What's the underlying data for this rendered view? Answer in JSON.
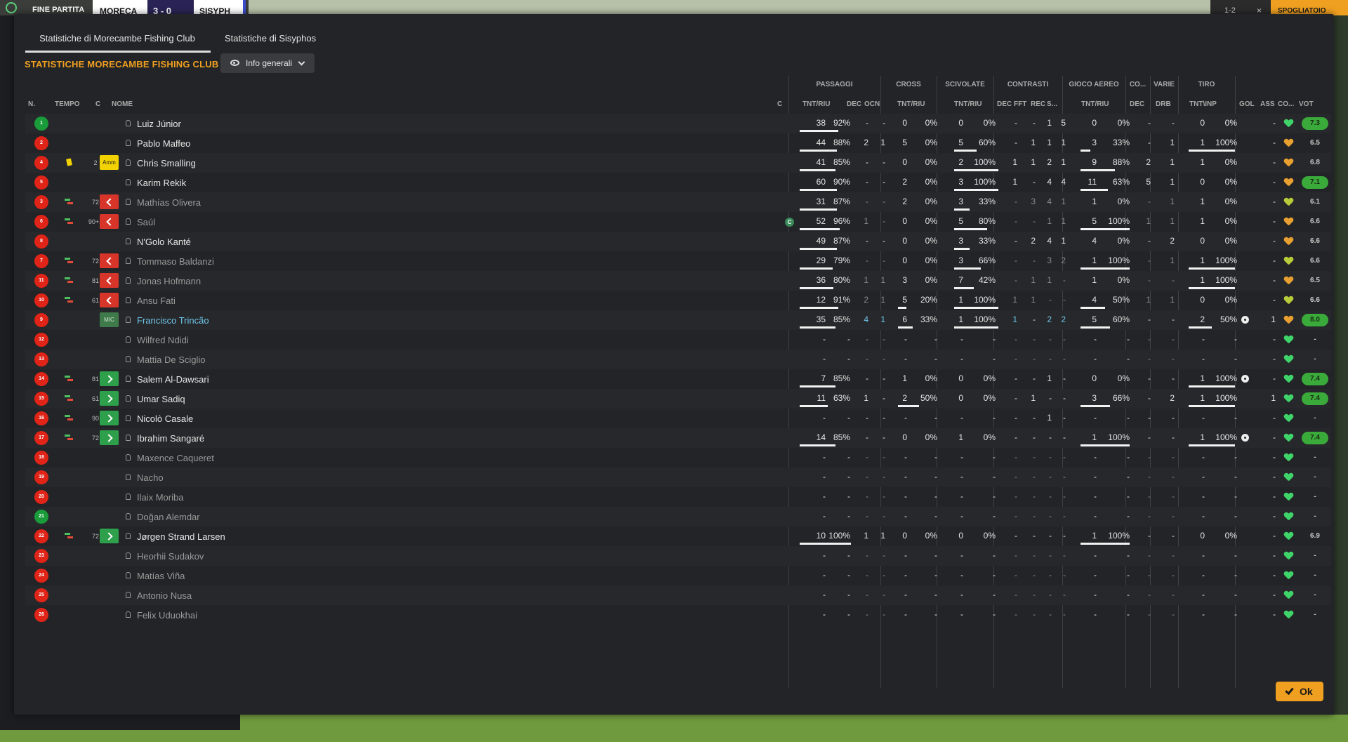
{
  "topbar": {
    "label": "FINE PARTITA",
    "team1": "MORECA",
    "score": "3 - 0",
    "team2": "SISYPH",
    "right1": "1-2",
    "right2": "×",
    "right3": "SPOGLIATOIO"
  },
  "dialog": {
    "tabs": [
      "Statistiche di Morecambe Fishing Club",
      "Statistiche di Sisyphos"
    ],
    "title": "STATISTICHE MORECAMBE FISHING CLUB",
    "dropdown": "Info generali",
    "ok": "Ok"
  },
  "groups": [
    "PASSAGGI",
    "CROSS",
    "SCIVOLATE",
    "CONTRASTI",
    "GIOCO AEREO",
    "CO...",
    "VARIE",
    "TIRO"
  ],
  "headers": {
    "n": "N.",
    "tempo": "TEMPO",
    "c": "C",
    "nome": "NOME",
    "c2": "C",
    "pass_tnt": "TNT/RIU",
    "pass_dec": "DEC",
    "pass_ocn": "OCN",
    "cross_tnt": "TNT/RIU",
    "sciv_tnt": "TNT/RIU",
    "con_dec": "DEC",
    "con_fft": "FFT",
    "con_rec": "REC",
    "con_s": "S...",
    "aer_tnt": "TNT/RIU",
    "co_dec": "DEC",
    "var_drb": "DRB",
    "tiro_tnt": "TNT\\INP",
    "gol": "GOL",
    "ass": "ASS",
    "co": "CO...",
    "vot": "VOT"
  },
  "accent": "#f0a020",
  "players": [
    {
      "n": "1",
      "nc": "green",
      "yellow": false,
      "sub": "",
      "min": "",
      "box": "",
      "name": "Luiz Júnior",
      "style": "",
      "capt": false,
      "p": [
        "38",
        "92%",
        "-",
        "-",
        "0",
        "0%",
        "0",
        "0%",
        "-",
        "-",
        "1",
        "5",
        "0",
        "0%",
        "-",
        "-",
        "0",
        "0%"
      ],
      "pw": [
        0.75,
        0,
        0.0,
        0
      ],
      "gol": "",
      "ass": "-",
      "heart": "g",
      "vot": "7.3",
      "votc": "g"
    },
    {
      "n": "2",
      "nc": "red",
      "yellow": false,
      "sub": "",
      "min": "",
      "box": "",
      "name": "Pablo Maffeo",
      "style": "",
      "capt": false,
      "p": [
        "44",
        "88%",
        "2",
        "1",
        "5",
        "0%",
        "5",
        "60%",
        "-",
        "1",
        "1",
        "1",
        "3",
        "33%",
        "-",
        "1",
        "1",
        "100%"
      ],
      "pw": [
        0.73,
        0,
        0.5,
        0.2,
        1
      ],
      "gol": "",
      "ass": "-",
      "heart": "o",
      "vot": "6.5",
      "votc": "n"
    },
    {
      "n": "4",
      "nc": "red",
      "yellow": true,
      "sub": "",
      "min": "2",
      "box": "amm",
      "boxlabel": "Amm",
      "name": "Chris Smalling",
      "style": "",
      "capt": false,
      "p": [
        "41",
        "85%",
        "-",
        "-",
        "0",
        "0%",
        "2",
        "100%",
        "1",
        "1",
        "2",
        "1",
        "9",
        "88%",
        "2",
        "1",
        "1",
        "0%"
      ],
      "pw": [
        0.7,
        0,
        1,
        0.7,
        0
      ],
      "gol": "",
      "ass": "-",
      "heart": "o",
      "vot": "6.8",
      "votc": "n"
    },
    {
      "n": "5",
      "nc": "red",
      "yellow": false,
      "sub": "",
      "min": "",
      "box": "",
      "name": "Karim Rekik",
      "style": "",
      "capt": false,
      "p": [
        "60",
        "90%",
        "-",
        "-",
        "2",
        "0%",
        "3",
        "100%",
        "1",
        "-",
        "4",
        "4",
        "11",
        "63%",
        "5",
        "1",
        "0",
        "0%"
      ],
      "pw": [
        0.73,
        0,
        1,
        0.55,
        0
      ],
      "gol": "",
      "ass": "-",
      "heart": "o",
      "vot": "7.1",
      "votc": "g"
    },
    {
      "n": "3",
      "nc": "red",
      "yellow": false,
      "sub": "swap",
      "min": "72",
      "box": "out",
      "name": "Mathías Olivera",
      "style": "dim",
      "capt": false,
      "p": [
        "31",
        "87%",
        "-",
        "-",
        "2",
        "0%",
        "3",
        "33%",
        "-",
        "3",
        "4",
        "1",
        "1",
        "0%",
        "-",
        "1",
        "1",
        "0%"
      ],
      "pw": [
        0.72,
        0,
        0.35,
        0,
        0
      ],
      "gol": "",
      "ass": "-",
      "heart": "y",
      "vot": "6.1",
      "votc": "n"
    },
    {
      "n": "6",
      "nc": "red",
      "yellow": false,
      "sub": "swap",
      "min": "90+1",
      "box": "out",
      "name": "Saúl",
      "style": "dim",
      "capt": true,
      "captlabel": "C",
      "p": [
        "52",
        "96%",
        "1",
        "-",
        "0",
        "0%",
        "5",
        "80%",
        "-",
        "-",
        "1",
        "1",
        "5",
        "100%",
        "1",
        "1",
        "1",
        "0%"
      ],
      "pw": [
        0.78,
        0,
        0.75,
        1,
        0
      ],
      "gol": "",
      "ass": "-",
      "heart": "o",
      "vot": "6.6",
      "votc": "n"
    },
    {
      "n": "8",
      "nc": "red",
      "yellow": false,
      "sub": "",
      "min": "",
      "box": "",
      "name": "N'Golo Kanté",
      "style": "",
      "capt": false,
      "p": [
        "49",
        "87%",
        "-",
        "-",
        "0",
        "0%",
        "3",
        "33%",
        "-",
        "2",
        "4",
        "1",
        "4",
        "0%",
        "-",
        "2",
        "0",
        "0%"
      ],
      "pw": [
        0.72,
        0,
        0.35,
        0,
        0
      ],
      "gol": "",
      "ass": "-",
      "heart": "o",
      "vot": "6.6",
      "votc": "n"
    },
    {
      "n": "7",
      "nc": "red",
      "yellow": false,
      "sub": "swap",
      "min": "72",
      "box": "out",
      "name": "Tommaso Baldanzi",
      "style": "dim",
      "capt": false,
      "p": [
        "29",
        "79%",
        "-",
        "-",
        "0",
        "0%",
        "3",
        "66%",
        "-",
        "-",
        "3",
        "2",
        "1",
        "100%",
        "-",
        "1",
        "1",
        "100%"
      ],
      "pw": [
        0.65,
        0,
        0.6,
        1,
        1
      ],
      "gol": "",
      "ass": "-",
      "heart": "y",
      "vot": "6.6",
      "votc": "n"
    },
    {
      "n": "11",
      "nc": "red",
      "yellow": false,
      "sub": "swap",
      "min": "81",
      "box": "out",
      "name": "Jonas Hofmann",
      "style": "dim",
      "capt": false,
      "p": [
        "36",
        "80%",
        "1",
        "1",
        "3",
        "0%",
        "7",
        "42%",
        "-",
        "1",
        "1",
        "-",
        "1",
        "0%",
        "-",
        "-",
        "1",
        "100%"
      ],
      "pw": [
        0.66,
        0,
        0.45,
        0,
        1
      ],
      "gol": "",
      "ass": "-",
      "heart": "o",
      "vot": "6.5",
      "votc": "n"
    },
    {
      "n": "10",
      "nc": "red",
      "yellow": false,
      "sub": "swap",
      "min": "61",
      "box": "out",
      "name": "Ansu Fati",
      "style": "dim",
      "capt": false,
      "p": [
        "12",
        "91%",
        "2",
        "1",
        "5",
        "20%",
        "1",
        "100%",
        "1",
        "1",
        "-",
        "-",
        "4",
        "50%",
        "1",
        "1",
        "0",
        "0%"
      ],
      "pw": [
        0.75,
        0.2,
        1,
        0.5,
        0
      ],
      "gol": "",
      "ass": "-",
      "heart": "y",
      "vot": "6.6",
      "votc": "n"
    },
    {
      "n": "9",
      "nc": "red",
      "yellow": false,
      "sub": "",
      "min": "",
      "box": "mic",
      "boxlabel": "MIC",
      "name": "Francisco Trincão",
      "style": "blue",
      "capt": false,
      "p": [
        "35",
        "85%",
        "4",
        "1",
        "6",
        "33%",
        "1",
        "100%",
        "1",
        "-",
        "2",
        "2",
        "5",
        "60%",
        "-",
        "-",
        "2",
        "50%"
      ],
      "pw": [
        0.7,
        0.35,
        1,
        0.6,
        0.5
      ],
      "gol": "ball",
      "ass": "1",
      "heart": "o",
      "vot": "8.0",
      "votc": "g"
    },
    {
      "n": "12",
      "nc": "red",
      "yellow": false,
      "sub": "",
      "min": "",
      "box": "",
      "name": "Wilfred Ndidi",
      "style": "dim",
      "capt": false,
      "p": [
        "-",
        "-",
        "-",
        "-",
        "-",
        "-",
        "-",
        "-",
        "-",
        "-",
        "-",
        "-",
        "-",
        "-",
        "-",
        "-",
        "-",
        "-"
      ],
      "pw": [],
      "gol": "",
      "ass": "-",
      "heart": "g",
      "vot": "-",
      "votc": "n"
    },
    {
      "n": "13",
      "nc": "red",
      "yellow": false,
      "sub": "",
      "min": "",
      "box": "",
      "name": "Mattia De Sciglio",
      "style": "dim",
      "capt": false,
      "p": [
        "-",
        "-",
        "-",
        "-",
        "-",
        "-",
        "-",
        "-",
        "-",
        "-",
        "-",
        "-",
        "-",
        "-",
        "-",
        "-",
        "-",
        "-"
      ],
      "pw": [],
      "gol": "",
      "ass": "-",
      "heart": "g",
      "vot": "-",
      "votc": "n"
    },
    {
      "n": "14",
      "nc": "red",
      "yellow": false,
      "sub": "swap",
      "min": "81",
      "box": "in",
      "name": "Salem Al-Dawsari",
      "style": "",
      "capt": false,
      "p": [
        "7",
        "85%",
        "-",
        "-",
        "1",
        "0%",
        "0",
        "0%",
        "-",
        "-",
        "1",
        "-",
        "0",
        "0%",
        "-",
        "-",
        "1",
        "100%"
      ],
      "pw": [
        0.7,
        0,
        0,
        0,
        1
      ],
      "gol": "ball",
      "ass": "-",
      "heart": "g",
      "vot": "7.4",
      "votc": "g"
    },
    {
      "n": "15",
      "nc": "red",
      "yellow": false,
      "sub": "swap",
      "min": "61",
      "box": "in",
      "name": "Umar Sadiq",
      "style": "",
      "capt": false,
      "p": [
        "11",
        "63%",
        "1",
        "-",
        "2",
        "50%",
        "0",
        "0%",
        "-",
        "1",
        "-",
        "-",
        "3",
        "66%",
        "-",
        "2",
        "1",
        "100%"
      ],
      "pw": [
        0.55,
        0.5,
        0,
        0.6,
        1
      ],
      "gol": "",
      "ass": "1",
      "heart": "g",
      "vot": "7.4",
      "votc": "g"
    },
    {
      "n": "16",
      "nc": "red",
      "yellow": false,
      "sub": "swap",
      "min": "90",
      "box": "in",
      "name": "Nicolò Casale",
      "style": "",
      "capt": false,
      "p": [
        "-",
        "-",
        "-",
        "-",
        "-",
        "-",
        "-",
        "-",
        "-",
        "-",
        "1",
        "-",
        "-",
        "-",
        "-",
        "-",
        "-",
        "-"
      ],
      "pw": [],
      "gol": "",
      "ass": "-",
      "heart": "g",
      "vot": "-",
      "votc": "n"
    },
    {
      "n": "17",
      "nc": "red",
      "yellow": false,
      "sub": "swap",
      "min": "72",
      "box": "in",
      "name": "Ibrahim Sangaré",
      "style": "",
      "capt": false,
      "p": [
        "14",
        "85%",
        "-",
        "-",
        "0",
        "0%",
        "1",
        "0%",
        "-",
        "-",
        "-",
        "-",
        "1",
        "100%",
        "-",
        "-",
        "1",
        "100%"
      ],
      "pw": [
        0.7,
        0,
        0,
        1,
        1
      ],
      "gol": "ball",
      "ass": "-",
      "heart": "g",
      "vot": "7.4",
      "votc": "g"
    },
    {
      "n": "18",
      "nc": "red",
      "yellow": false,
      "sub": "",
      "min": "",
      "box": "",
      "name": "Maxence Caqueret",
      "style": "dim",
      "capt": false,
      "p": [
        "-",
        "-",
        "-",
        "-",
        "-",
        "-",
        "-",
        "-",
        "-",
        "-",
        "-",
        "-",
        "-",
        "-",
        "-",
        "-",
        "-",
        "-"
      ],
      "pw": [],
      "gol": "",
      "ass": "-",
      "heart": "g",
      "vot": "-",
      "votc": "n"
    },
    {
      "n": "19",
      "nc": "red",
      "yellow": false,
      "sub": "",
      "min": "",
      "box": "",
      "name": "Nacho",
      "style": "dim",
      "capt": false,
      "p": [
        "-",
        "-",
        "-",
        "-",
        "-",
        "-",
        "-",
        "-",
        "-",
        "-",
        "-",
        "-",
        "-",
        "-",
        "-",
        "-",
        "-",
        "-"
      ],
      "pw": [],
      "gol": "",
      "ass": "-",
      "heart": "g",
      "vot": "-",
      "votc": "n"
    },
    {
      "n": "20",
      "nc": "red",
      "yellow": false,
      "sub": "",
      "min": "",
      "box": "",
      "name": "Ilaix Moriba",
      "style": "dim",
      "capt": false,
      "p": [
        "-",
        "-",
        "-",
        "-",
        "-",
        "-",
        "-",
        "-",
        "-",
        "-",
        "-",
        "-",
        "-",
        "-",
        "-",
        "-",
        "-",
        "-"
      ],
      "pw": [],
      "gol": "",
      "ass": "-",
      "heart": "g",
      "vot": "-",
      "votc": "n"
    },
    {
      "n": "21",
      "nc": "green",
      "yellow": false,
      "sub": "",
      "min": "",
      "box": "",
      "name": "Doğan Alemdar",
      "style": "dim",
      "capt": false,
      "p": [
        "-",
        "-",
        "-",
        "-",
        "-",
        "-",
        "-",
        "-",
        "-",
        "-",
        "-",
        "-",
        "-",
        "-",
        "-",
        "-",
        "-",
        "-"
      ],
      "pw": [],
      "gol": "",
      "ass": "-",
      "heart": "g",
      "vot": "-",
      "votc": "n"
    },
    {
      "n": "22",
      "nc": "red",
      "yellow": false,
      "sub": "swap",
      "min": "72",
      "box": "in",
      "name": "Jørgen Strand Larsen",
      "style": "",
      "capt": false,
      "p": [
        "10",
        "100%",
        "1",
        "1",
        "0",
        "0%",
        "0",
        "0%",
        "-",
        "-",
        "-",
        "-",
        "1",
        "100%",
        "-",
        "-",
        "0",
        "0%"
      ],
      "pw": [
        1,
        0,
        0,
        1,
        0
      ],
      "gol": "",
      "ass": "-",
      "heart": "g",
      "vot": "6.9",
      "votc": "n"
    },
    {
      "n": "23",
      "nc": "red",
      "yellow": false,
      "sub": "",
      "min": "",
      "box": "",
      "name": "Heorhii Sudakov",
      "style": "dim",
      "capt": false,
      "p": [
        "-",
        "-",
        "-",
        "-",
        "-",
        "-",
        "-",
        "-",
        "-",
        "-",
        "-",
        "-",
        "-",
        "-",
        "-",
        "-",
        "-",
        "-"
      ],
      "pw": [],
      "gol": "",
      "ass": "-",
      "heart": "g",
      "vot": "-",
      "votc": "n"
    },
    {
      "n": "24",
      "nc": "red",
      "yellow": false,
      "sub": "",
      "min": "",
      "box": "",
      "name": "Matías Viña",
      "style": "dim",
      "capt": false,
      "p": [
        "-",
        "-",
        "-",
        "-",
        "-",
        "-",
        "-",
        "-",
        "-",
        "-",
        "-",
        "-",
        "-",
        "-",
        "-",
        "-",
        "-",
        "-"
      ],
      "pw": [],
      "gol": "",
      "ass": "-",
      "heart": "g",
      "vot": "-",
      "votc": "n"
    },
    {
      "n": "25",
      "nc": "red",
      "yellow": false,
      "sub": "",
      "min": "",
      "box": "",
      "name": "Antonio Nusa",
      "style": "dim",
      "capt": false,
      "p": [
        "-",
        "-",
        "-",
        "-",
        "-",
        "-",
        "-",
        "-",
        "-",
        "-",
        "-",
        "-",
        "-",
        "-",
        "-",
        "-",
        "-",
        "-"
      ],
      "pw": [],
      "gol": "",
      "ass": "-",
      "heart": "g",
      "vot": "-",
      "votc": "n"
    },
    {
      "n": "26",
      "nc": "red",
      "yellow": false,
      "sub": "",
      "min": "",
      "box": "",
      "name": "Felix Uduokhai",
      "style": "dim",
      "capt": false,
      "p": [
        "-",
        "-",
        "-",
        "-",
        "-",
        "-",
        "-",
        "-",
        "-",
        "-",
        "-",
        "-",
        "-",
        "-",
        "-",
        "-",
        "-",
        "-"
      ],
      "pw": [],
      "gol": "",
      "ass": "-",
      "heart": "g",
      "vot": "-",
      "votc": "n"
    }
  ]
}
